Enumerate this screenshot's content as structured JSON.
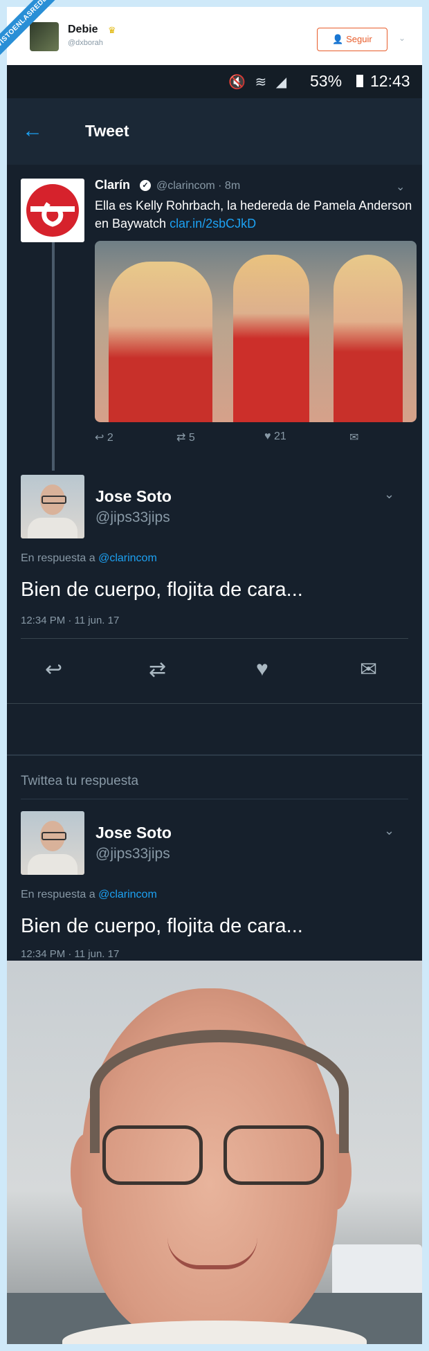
{
  "top_card": {
    "ribbon": "VISTOENLASREDES",
    "name": "Debie",
    "crown_icon": "crown-icon",
    "handle": "@dxborah",
    "follow_label": "Seguir"
  },
  "status_bar": {
    "battery": "53%",
    "time": "12:43"
  },
  "app_bar": {
    "title": "Tweet"
  },
  "quoted_tweet": {
    "name": "Clarín",
    "handle": "@clarincom · 8m",
    "text": "Ella es Kelly Rohrbach, la hedereda de Pamela Anderson en Baywatch ",
    "link": "clar.in/2sbCJkD",
    "replies": "2",
    "retweets": "5",
    "likes": "21"
  },
  "main_tweet": {
    "name": "Jose Soto",
    "handle": "@jips33jips",
    "reply_prefix": "En respuesta a ",
    "reply_to": "@clarincom",
    "body": "Bien de cuerpo, flojita de cara...",
    "time": "12:34 PM · 11 jun. 17"
  },
  "reply_box": {
    "placeholder": "Twittea tu respuesta"
  },
  "repeat_tweet": {
    "name": "Jose Soto",
    "handle": "@jips33jips",
    "reply_prefix": "En respuesta a ",
    "reply_to": "@clarincom",
    "body": "Bien de cuerpo, flojita de cara...",
    "time": "12:34 PM · 11 jun. 17"
  },
  "colors": {
    "background": "#16202c",
    "accent": "#1da1f2",
    "muted": "#8899a6",
    "follow": "#e85c2a"
  }
}
